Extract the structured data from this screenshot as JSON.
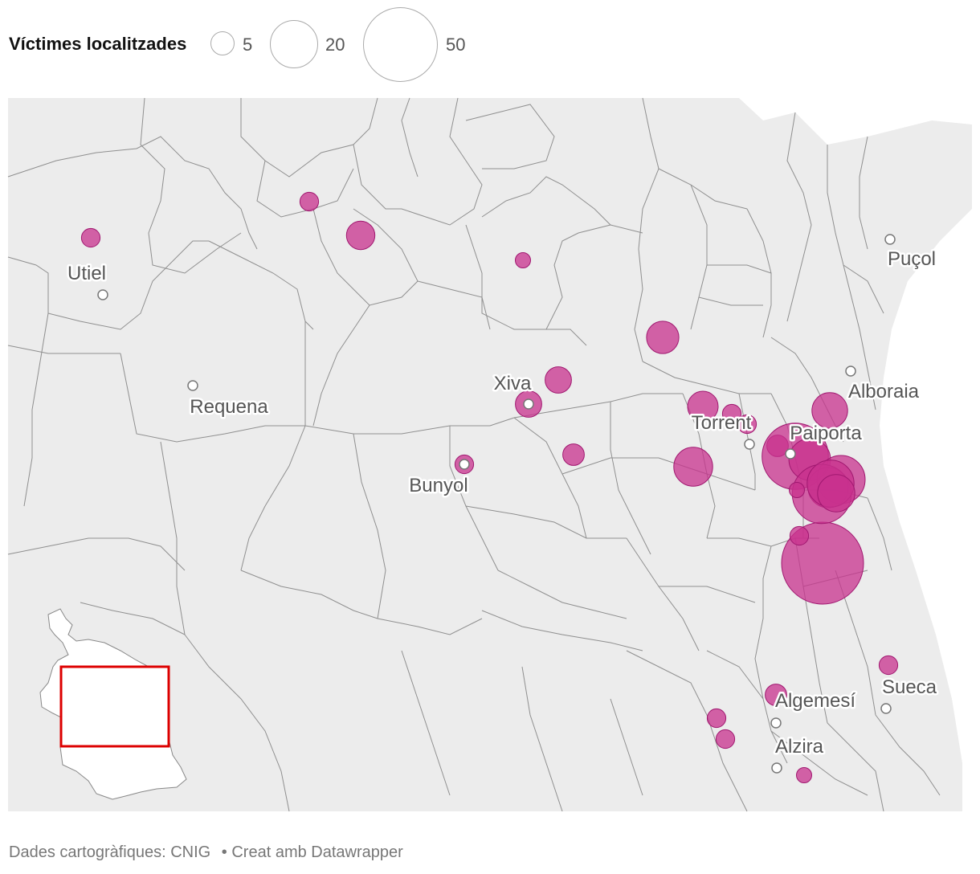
{
  "legend": {
    "title": "Víctimes localitzades",
    "sizes": [
      {
        "label": "5",
        "value": 5
      },
      {
        "label": "20",
        "value": 20
      },
      {
        "label": "50",
        "value": 50
      }
    ]
  },
  "map": {
    "colors": {
      "land": "#ececec",
      "border": "#8f8f8f",
      "bubble": "#c8328e",
      "city": "#ffffff"
    },
    "cities": [
      {
        "name": "Utiel"
      },
      {
        "name": "Requena"
      },
      {
        "name": "Xiva"
      },
      {
        "name": "Bunyol"
      },
      {
        "name": "Torrent"
      },
      {
        "name": "Paiporta"
      },
      {
        "name": "Alboraia"
      },
      {
        "name": "Puçol"
      },
      {
        "name": "Algemesí"
      },
      {
        "name": "Alzira"
      },
      {
        "name": "Sueca"
      }
    ],
    "victims": [
      3,
      3,
      7,
      2,
      6,
      6,
      3,
      9,
      4,
      13,
      8,
      3,
      11,
      3,
      4,
      38,
      15,
      58,
      20,
      14,
      30,
      19,
      12,
      3,
      4,
      3,
      3,
      2,
      3,
      2
    ],
    "inset": {
      "highlight_color": "#dd0000"
    }
  },
  "footer": {
    "source": "Dades cartogràfiques: CNIG",
    "credit": "• Creat amb Datawrapper"
  }
}
